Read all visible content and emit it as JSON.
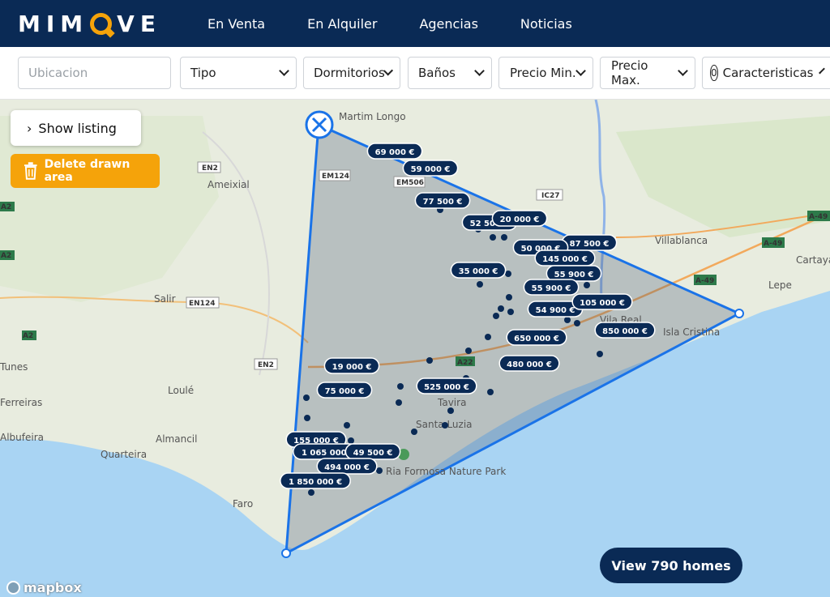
{
  "brand": {
    "name_left": "MIM",
    "name_right": "VE",
    "accent": "#f5a30a",
    "navy": "#0a2a55"
  },
  "nav": [
    "En Venta",
    "En Alquiler",
    "Agencias",
    "Noticias"
  ],
  "filters": {
    "location_placeholder": "Ubicacion",
    "tipo": "Tipo",
    "dormitorios": "Dormitorios",
    "banos": "Baños",
    "precio_min": "Precio Min.",
    "precio_max": "Precio Max.",
    "caracteristicas_count": "0",
    "caracteristicas": "Caracteristicas"
  },
  "map": {
    "show_listing": "Show listing",
    "delete_area": "Delete drawn area",
    "view_homes": "View 790 homes",
    "attribution": "mapbox",
    "places": [
      {
        "text": "Martim Longo"
      },
      {
        "text": "Ameixial"
      },
      {
        "text": "Salir"
      },
      {
        "text": "Loulé"
      },
      {
        "text": "Almancil"
      },
      {
        "text": "Quarteira"
      },
      {
        "text": "Faro"
      },
      {
        "text": "Villablanca"
      },
      {
        "text": "Lepe"
      },
      {
        "text": "Cartaya"
      },
      {
        "text": "Isla Cristina"
      },
      {
        "text": "Tavira"
      },
      {
        "text": "Santa Luzia"
      },
      {
        "text": "Ria Formosa Nature Park"
      },
      {
        "text": "Ferreiras"
      },
      {
        "text": "Albufeira"
      },
      {
        "text": "Tunes"
      },
      {
        "text": "Vila Real"
      }
    ],
    "roads": [
      "EN2",
      "EM124",
      "EM506",
      "IC27",
      "A-49",
      "A-49",
      "A-49",
      "EN124",
      "EN2",
      "A22",
      "A2",
      "A2",
      "A2"
    ],
    "price_tags": [
      "69 000 €",
      "59 000 €",
      "77 500 €",
      "52 500 €",
      "20 000 €",
      "87 500 €",
      "50 000 €",
      "145 000 €",
      "35 000 €",
      "55 900 €",
      "55 900 €",
      "54 900 €",
      "105 000 €",
      "850 000 €",
      "650 000 €",
      "480 000 €",
      "19 000 €",
      "75 000 €",
      "525 000 €",
      "155 000 €",
      "1 065 000 €",
      "49 500 €",
      "494 000 €",
      "1 850 000 €"
    ]
  }
}
